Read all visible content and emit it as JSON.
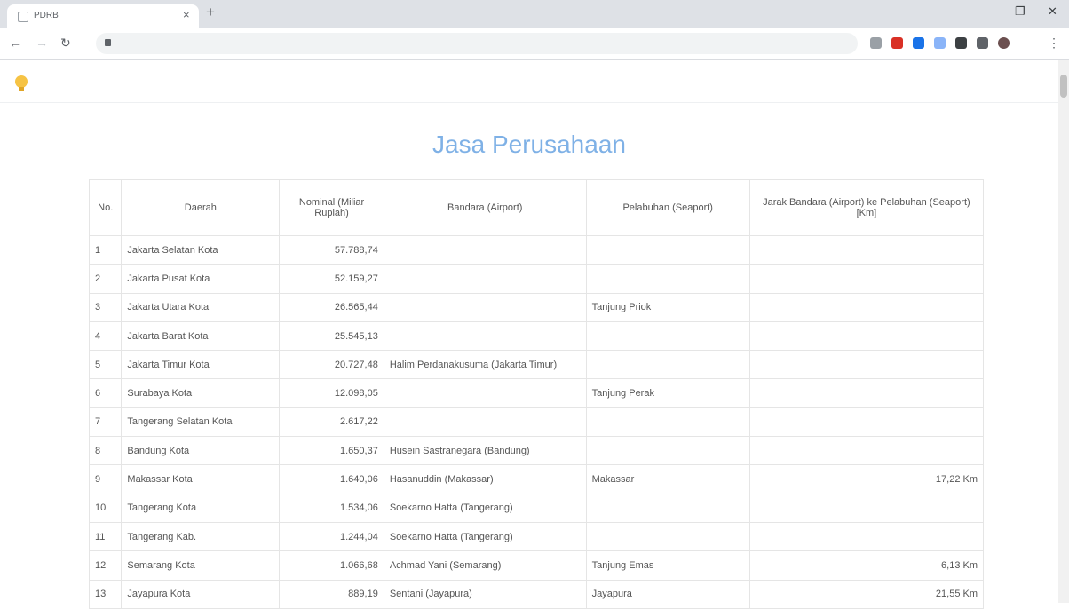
{
  "browser": {
    "tab_title": "PDRB",
    "tab_close": "×",
    "new_tab": "+",
    "window_controls": {
      "minimize": "–",
      "maximize": "❐",
      "close": "✕"
    },
    "nav": {
      "back": "←",
      "forward": "→",
      "reload": "↻"
    },
    "url": "",
    "extension_colors": [
      "#9aa0a6",
      "#d93025",
      "#1a73e8",
      "#8ab4f8",
      "#3c4043",
      "#5f6368",
      "#6b4f4f"
    ]
  },
  "site": {
    "logo_icon": "lightbulb-logo-icon",
    "menu": [
      "",
      "",
      "",
      "",
      "",
      ""
    ]
  },
  "page": {
    "title": "Jasa Perusahaan"
  },
  "table": {
    "headers": {
      "no": "No.",
      "daerah": "Daerah",
      "nominal": "Nominal (Miliar Rupiah)",
      "bandara": "Bandara (Airport)",
      "pelabuhan": "Pelabuhan (Seaport)",
      "jarak": "Jarak Bandara (Airport) ke Pelabuhan (Seaport) [Km]"
    },
    "rows": [
      {
        "no": "1",
        "daerah": "Jakarta Selatan Kota",
        "nominal": "57.788,74",
        "bandara": "",
        "pelabuhan": "",
        "jarak": ""
      },
      {
        "no": "2",
        "daerah": "Jakarta Pusat Kota",
        "nominal": "52.159,27",
        "bandara": "",
        "pelabuhan": "",
        "jarak": ""
      },
      {
        "no": "3",
        "daerah": "Jakarta Utara Kota",
        "nominal": "26.565,44",
        "bandara": "",
        "pelabuhan": "Tanjung Priok",
        "jarak": ""
      },
      {
        "no": "4",
        "daerah": "Jakarta Barat Kota",
        "nominal": "25.545,13",
        "bandara": "",
        "pelabuhan": "",
        "jarak": ""
      },
      {
        "no": "5",
        "daerah": "Jakarta Timur Kota",
        "nominal": "20.727,48",
        "bandara": "Halim Perdanakusuma (Jakarta Timur)",
        "pelabuhan": "",
        "jarak": ""
      },
      {
        "no": "6",
        "daerah": "Surabaya Kota",
        "nominal": "12.098,05",
        "bandara": "",
        "pelabuhan": "Tanjung Perak",
        "jarak": ""
      },
      {
        "no": "7",
        "daerah": "Tangerang Selatan Kota",
        "nominal": "2.617,22",
        "bandara": "",
        "pelabuhan": "",
        "jarak": ""
      },
      {
        "no": "8",
        "daerah": "Bandung Kota",
        "nominal": "1.650,37",
        "bandara": "Husein Sastranegara (Bandung)",
        "pelabuhan": "",
        "jarak": ""
      },
      {
        "no": "9",
        "daerah": "Makassar Kota",
        "nominal": "1.640,06",
        "bandara": "Hasanuddin (Makassar)",
        "pelabuhan": "Makassar",
        "jarak": "17,22 Km"
      },
      {
        "no": "10",
        "daerah": "Tangerang Kota",
        "nominal": "1.534,06",
        "bandara": "Soekarno Hatta (Tangerang)",
        "pelabuhan": "",
        "jarak": ""
      },
      {
        "no": "11",
        "daerah": "Tangerang Kab.",
        "nominal": "1.244,04",
        "bandara": "Soekarno Hatta (Tangerang)",
        "pelabuhan": "",
        "jarak": ""
      },
      {
        "no": "12",
        "daerah": "Semarang Kota",
        "nominal": "1.066,68",
        "bandara": "Achmad Yani (Semarang)",
        "pelabuhan": "Tanjung Emas",
        "jarak": "6,13 Km"
      },
      {
        "no": "13",
        "daerah": "Jayapura Kota",
        "nominal": "889,19",
        "bandara": "Sentani (Jayapura)",
        "pelabuhan": "Jayapura",
        "jarak": "21,55 Km"
      }
    ]
  }
}
